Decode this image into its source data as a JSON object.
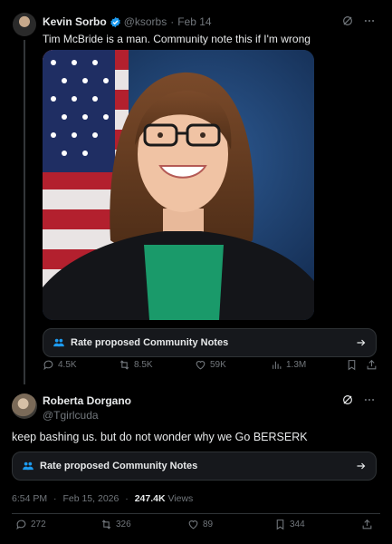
{
  "post1": {
    "author_name": "Kevin Sorbo",
    "handle": "@ksorbs",
    "separator": "·",
    "date": "Feb 14",
    "text": "Tim McBride is a man. Community note this if I'm wrong",
    "community_notes_label": "Rate proposed Community Notes",
    "actions": {
      "replies": "4.5K",
      "reposts": "8.5K",
      "likes": "59K",
      "views": "1.3M"
    }
  },
  "post2": {
    "author_name": "Roberta Dorgano",
    "handle": "@Tgirlcuda",
    "text": "keep bashing us. but do not wonder why we Go BERSERK",
    "community_notes_label": "Rate proposed Community Notes",
    "meta": {
      "time": "6:54 PM",
      "separator": "·",
      "date": "Feb 15, 2026",
      "views_count": "247.4K",
      "views_label": "Views"
    },
    "actions": {
      "replies": "272",
      "reposts": "326",
      "likes": "89",
      "bookmarks": "344"
    }
  },
  "colors": {
    "background": "#000000",
    "text": "#e7e9ea",
    "muted": "#71767b",
    "verified": "#1d9bf0",
    "border": "#2f3336"
  }
}
